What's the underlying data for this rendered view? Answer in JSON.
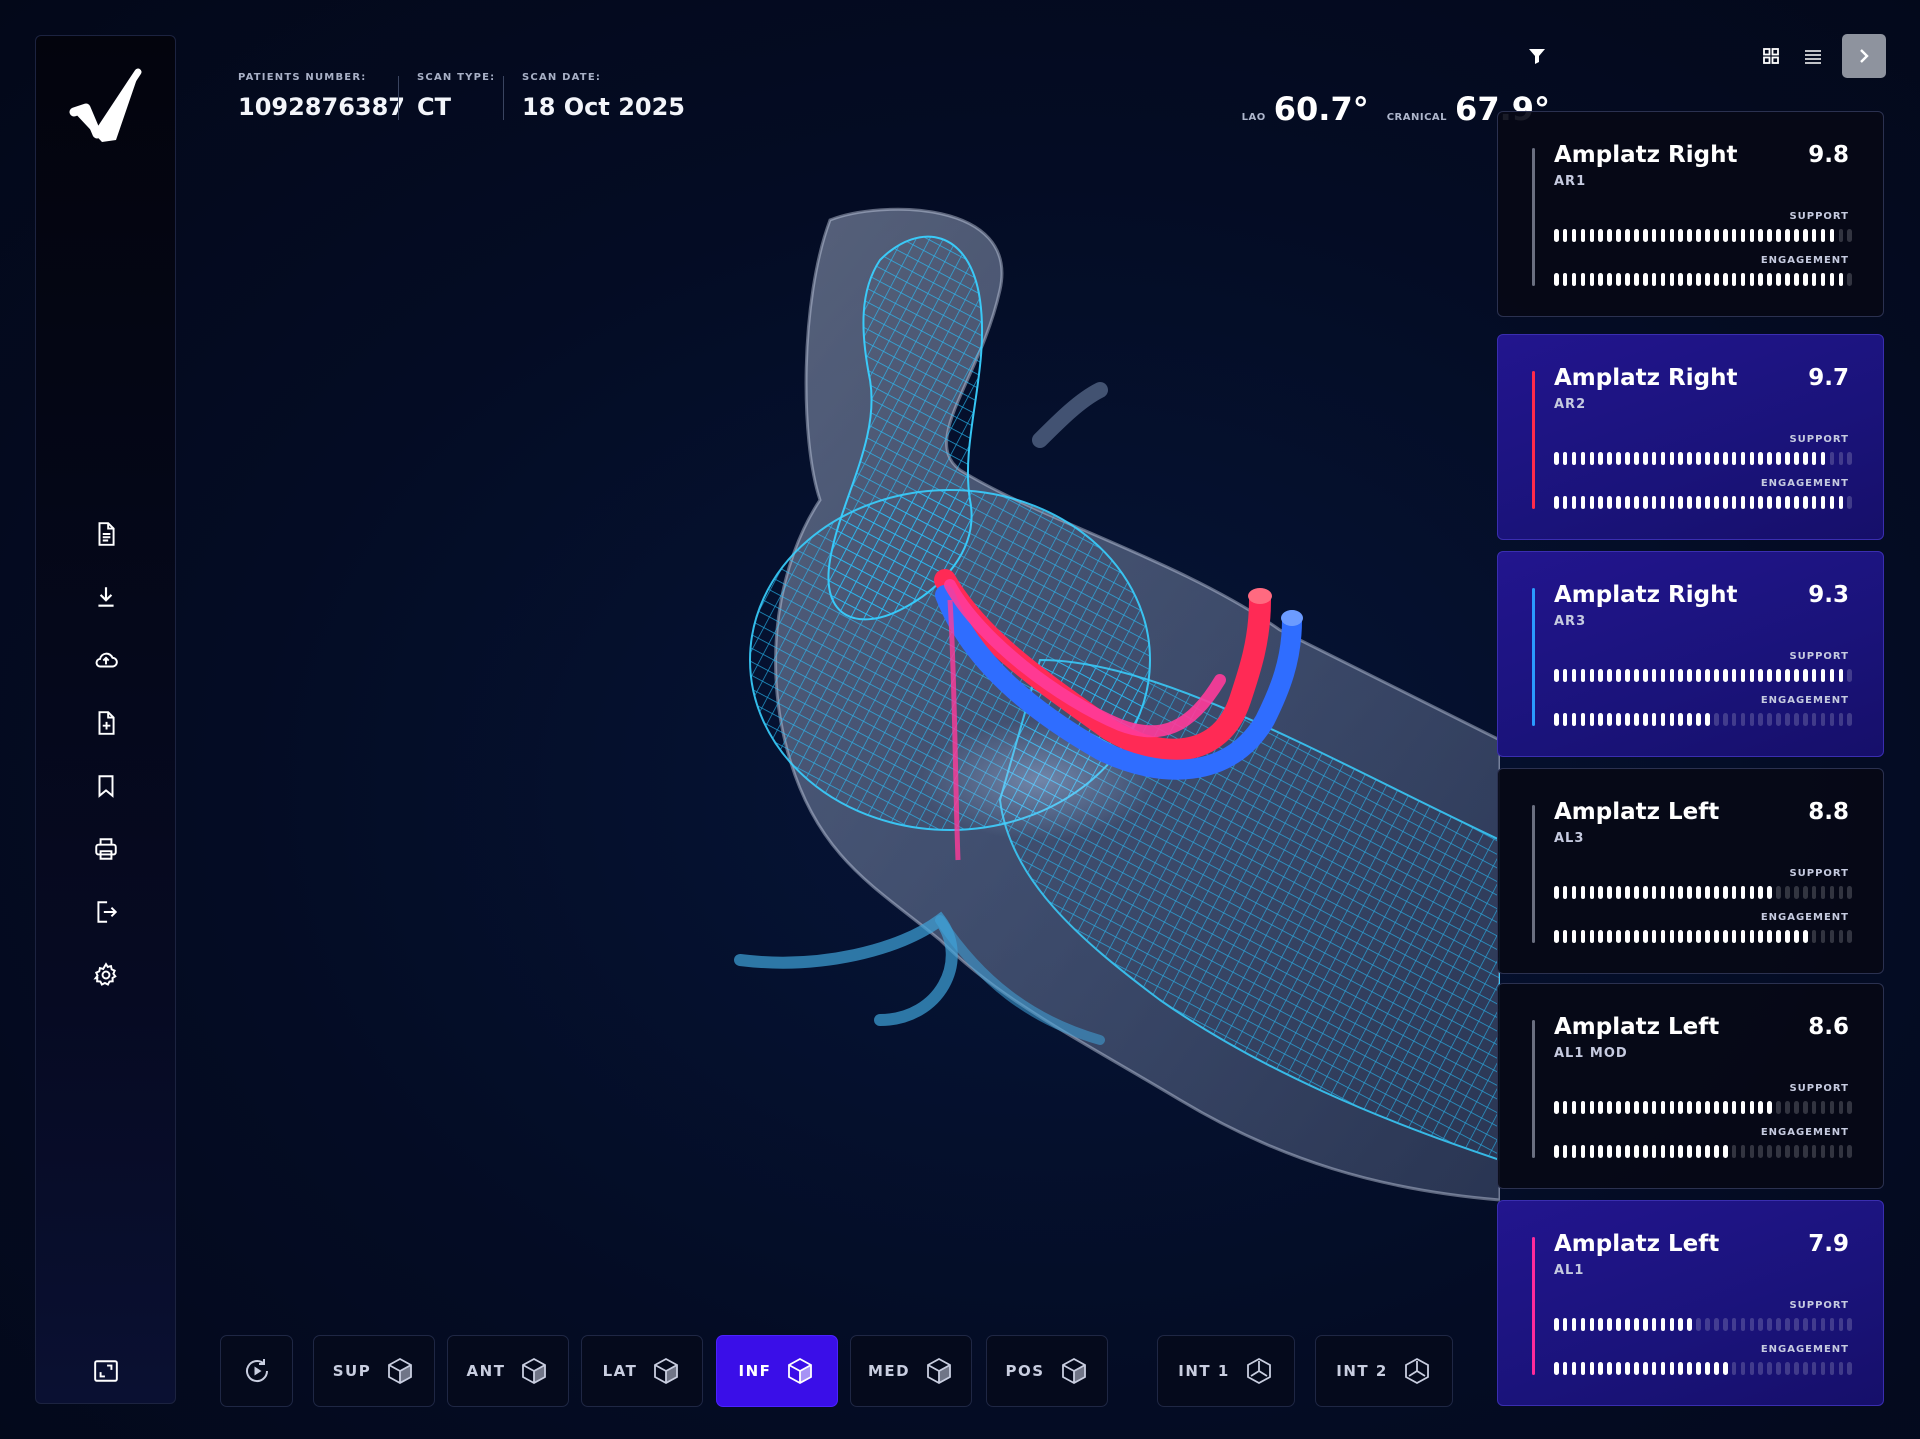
{
  "header": {
    "patients_number_label": "PATIENTS NUMBER:",
    "patients_number": "1092876387",
    "scan_type_label": "SCAN TYPE:",
    "scan_type": "CT",
    "scan_date_label": "SCAN DATE:",
    "scan_date": "18 Oct 2025"
  },
  "angles": {
    "lao_label": "LAO",
    "lao_value": "60.7°",
    "cranial_label": "CRANICAL",
    "cranial_value": "67.9°"
  },
  "colors": {
    "accent_purple": "#3a0ee8",
    "card_purple": "#22158e",
    "vessel_cyan": "#29c4ff",
    "catheter_red": "#ff2a55",
    "catheter_blue": "#2f6dff"
  },
  "cards": [
    {
      "name": "Amplatz Right",
      "code": "AR1",
      "score": "9.8",
      "style": "dark",
      "accent": "#6a6f80",
      "support_label": "SUPPORT",
      "engagement_label": "ENGAGEMENT",
      "support": 0.94,
      "engagement": 0.98
    },
    {
      "name": "Amplatz Right",
      "code": "AR2",
      "score": "9.7",
      "style": "purple",
      "accent": "#ff2a4a",
      "support_label": "SUPPORT",
      "engagement_label": "ENGAGEMENT",
      "support": 0.92,
      "engagement": 0.96
    },
    {
      "name": "Amplatz Right",
      "code": "AR3",
      "score": "9.3",
      "style": "purple",
      "accent": "#2a9bff",
      "support_label": "SUPPORT",
      "engagement_label": "ENGAGEMENT",
      "support": 0.96,
      "engagement": 0.52
    },
    {
      "name": "Amplatz Left",
      "code": "AL3",
      "score": "8.8",
      "style": "dark",
      "accent": "#6a6f80",
      "support_label": "SUPPORT",
      "engagement_label": "ENGAGEMENT",
      "support": 0.74,
      "engagement": 0.84
    },
    {
      "name": "Amplatz Left",
      "code": "AL1 MOD",
      "score": "8.6",
      "style": "dark",
      "accent": "#6a6f80",
      "support_label": "SUPPORT",
      "engagement_label": "ENGAGEMENT",
      "support": 0.74,
      "engagement": 0.58
    },
    {
      "name": "Amplatz Left",
      "code": "AL1",
      "score": "7.9",
      "style": "purple",
      "accent": "#ff2a9b",
      "support_label": "SUPPORT",
      "engagement_label": "ENGAGEMENT",
      "support": 0.46,
      "engagement": 0.58
    }
  ],
  "views": [
    {
      "label": "SUP",
      "icon": "cube-top-icon"
    },
    {
      "label": "ANT",
      "icon": "cube-front-icon"
    },
    {
      "label": "LAT",
      "icon": "cube-side-icon"
    },
    {
      "label": "INF",
      "icon": "cube-bottom-icon",
      "active": true
    },
    {
      "label": "MED",
      "icon": "cube-medial-icon"
    },
    {
      "label": "POS",
      "icon": "cube-back-icon"
    },
    {
      "label": "INT 1",
      "icon": "cube-outline-icon"
    },
    {
      "label": "INT 2",
      "icon": "cube-outline-icon"
    }
  ]
}
